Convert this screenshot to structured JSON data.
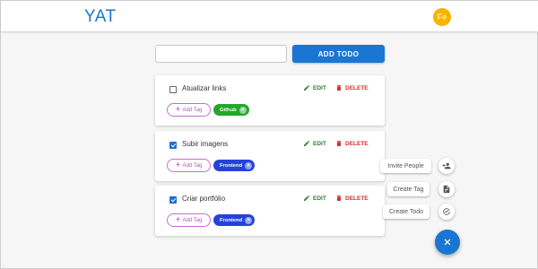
{
  "app": {
    "title": "YAT",
    "avatar_initials": "Fe"
  },
  "composer": {
    "input_value": "",
    "input_placeholder": "",
    "add_label": "ADD TODO"
  },
  "todos": [
    {
      "title": "Atualizar links",
      "checked": false,
      "edit_label": "EDIT",
      "delete_label": "DELETE",
      "add_tag_label": "Add Tag",
      "tag": {
        "label": "Github",
        "color": "#22a72a"
      }
    },
    {
      "title": "Subir imagens",
      "checked": true,
      "edit_label": "EDIT",
      "delete_label": "DELETE",
      "add_tag_label": "Add Tag",
      "tag": {
        "label": "Frontend",
        "color": "#2443d8"
      }
    },
    {
      "title": "Criar portfólio",
      "checked": true,
      "edit_label": "EDIT",
      "delete_label": "DELETE",
      "add_tag_label": "Add Tag",
      "tag": {
        "label": "Frontend",
        "color": "#2443d8"
      }
    }
  ],
  "speed_dial": {
    "actions": [
      {
        "label": "Invite People",
        "icon": "person-add-icon"
      },
      {
        "label": "Create Tag",
        "icon": "tag-add-icon"
      },
      {
        "label": "Create Todo",
        "icon": "add-task-icon"
      }
    ],
    "fab_icon": "close-icon"
  },
  "colors": {
    "primary": "#1976d2",
    "edit": "#2e7d32",
    "delete": "#d32f2f",
    "add_tag": "#b05ab9",
    "avatar": "#f5b400"
  }
}
